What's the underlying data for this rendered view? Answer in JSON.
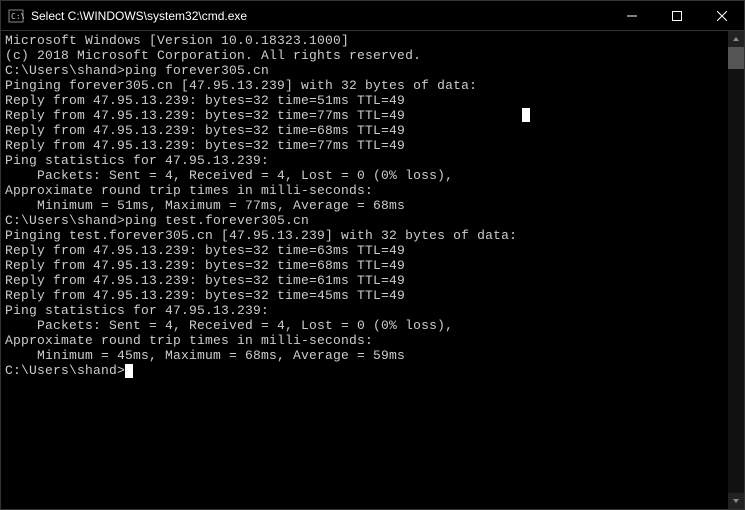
{
  "titlebar": {
    "icon": "cmd-icon",
    "title": "Select C:\\WINDOWS\\system32\\cmd.exe"
  },
  "terminal": {
    "lines": [
      "Microsoft Windows [Version 10.0.18323.1000]",
      "(c) 2018 Microsoft Corporation. All rights reserved.",
      "",
      "C:\\Users\\shand>ping forever305.cn",
      "",
      "Pinging forever305.cn [47.95.13.239] with 32 bytes of data:",
      "Reply from 47.95.13.239: bytes=32 time=51ms TTL=49",
      "Reply from 47.95.13.239: bytes=32 time=77ms TTL=49",
      "Reply from 47.95.13.239: bytes=32 time=68ms TTL=49",
      "Reply from 47.95.13.239: bytes=32 time=77ms TTL=49",
      "",
      "Ping statistics for 47.95.13.239:",
      "    Packets: Sent = 4, Received = 4, Lost = 0 (0% loss),",
      "Approximate round trip times in milli-seconds:",
      "    Minimum = 51ms, Maximum = 77ms, Average = 68ms",
      "",
      "C:\\Users\\shand>ping test.forever305.cn",
      "",
      "Pinging test.forever305.cn [47.95.13.239] with 32 bytes of data:",
      "Reply from 47.95.13.239: bytes=32 time=63ms TTL=49",
      "Reply from 47.95.13.239: bytes=32 time=68ms TTL=49",
      "Reply from 47.95.13.239: bytes=32 time=61ms TTL=49",
      "Reply from 47.95.13.239: bytes=32 time=45ms TTL=49",
      "",
      "Ping statistics for 47.95.13.239:",
      "    Packets: Sent = 4, Received = 4, Lost = 0 (0% loss),",
      "Approximate round trip times in milli-seconds:",
      "    Minimum = 45ms, Maximum = 68ms, Average = 59ms",
      "",
      "C:\\Users\\shand>"
    ],
    "prompt_cursor": true,
    "selection_cursor": {
      "col": 68,
      "row": 5
    }
  }
}
